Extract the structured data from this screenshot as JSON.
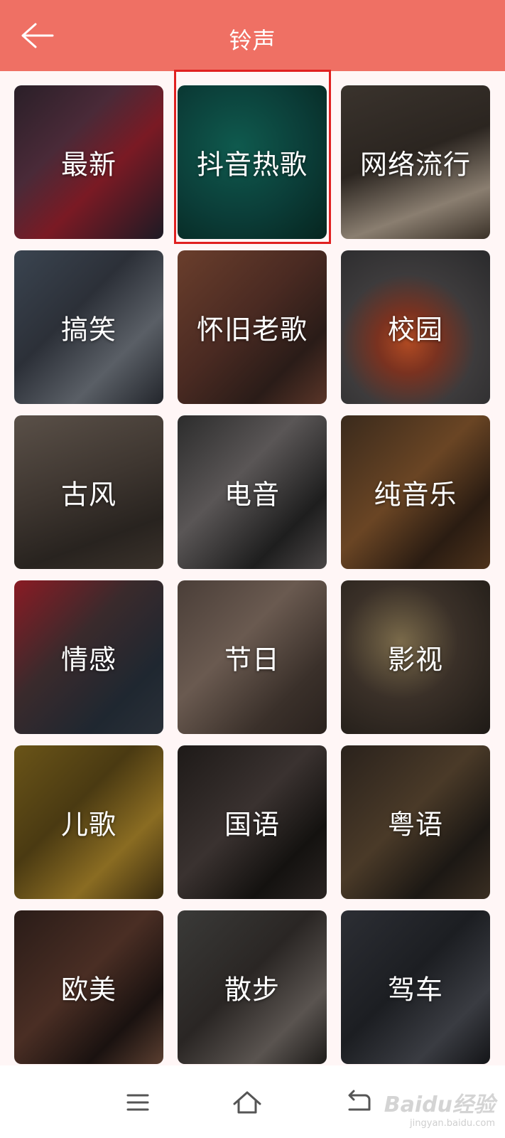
{
  "header": {
    "title": "铃声",
    "back_icon": "arrow-left-icon",
    "color": "#ef7064"
  },
  "categories": [
    {
      "label": "最新",
      "bg": "linear-gradient(135deg,#2a1f28 0%,#4a2a38 35%,#7a1a24 60%,#1d1a24 100%)"
    },
    {
      "label": "抖音热歌",
      "bg": "radial-gradient(circle at 40% 40%,#0f5a4e 0%,#0b3d38 55%,#06251f 100%)"
    },
    {
      "label": "网络流行",
      "bg": "linear-gradient(160deg,#3a332d 0%,#2b2520 45%,#8a7e70 75%,#3a3128 100%)"
    },
    {
      "label": "搞笑",
      "bg": "linear-gradient(135deg,#3a4450 0%,#2c3038 40%,#5a5f66 70%,#23262c 100%)"
    },
    {
      "label": "怀旧老歌",
      "bg": "linear-gradient(135deg,#6a3e2c 0%,#4a2a22 45%,#2a1c18 75%,#5a3528 100%)"
    },
    {
      "label": "校园",
      "bg": "radial-gradient(circle at 45% 60%,#b04a22 0%,#7a3220 25%,#3d3b3c 55%,#2a2a2c 100%)"
    },
    {
      "label": "古风",
      "bg": "linear-gradient(160deg,#5a5048 0%,#3e3630 45%,#28231f 75%,#3a322b 100%)"
    },
    {
      "label": "电音",
      "bg": "linear-gradient(135deg,#2c2c2c 0%,#5a5656 40%,#1e1e1e 75%,#4a4646 100%)"
    },
    {
      "label": "纯音乐",
      "bg": "linear-gradient(135deg,#3a2a1c 0%,#6a4524 45%,#2a1c12 75%,#4e331c 100%)"
    },
    {
      "label": "情感",
      "bg": "linear-gradient(135deg,#8a1b24 0%,#3a2a2c 40%,#1f2730 75%,#2a3038 100%)"
    },
    {
      "label": "节日",
      "bg": "linear-gradient(135deg,#4a3e38 0%,#6a5a50 40%,#3a302a 75%,#2a221e 100%)"
    },
    {
      "label": "影视",
      "bg": "radial-gradient(circle at 40% 40%,#7a6a4a 0%,#3a3028 45%,#1e1a16 100%)"
    },
    {
      "label": "儿歌",
      "bg": "linear-gradient(135deg,#6a5418 0%,#4a3a12 40%,#8a6c22 70%,#3a2c10 100%)"
    },
    {
      "label": "国语",
      "bg": "linear-gradient(135deg,#1e1a18 0%,#3a3230 45%,#141210 75%,#2a2422 100%)"
    },
    {
      "label": "粤语",
      "bg": "linear-gradient(135deg,#2a221c 0%,#4a3a28 45%,#1c1814 75%,#3a2e22 100%)"
    },
    {
      "label": "欧美",
      "bg": "linear-gradient(135deg,#2a1c18 0%,#4a2e24 45%,#1a1210 75%,#5a3e30 100%)"
    },
    {
      "label": "散步",
      "bg": "linear-gradient(135deg,#3a3a38 0%,#2a2624 45%,#5a5450 75%,#1e1c1a 100%)"
    },
    {
      "label": "驾车",
      "bg": "linear-gradient(135deg,#2c2e34 0%,#1c1e22 45%,#3a3c42 75%,#141518 100%)"
    }
  ],
  "highlight": {
    "target": "抖音热歌",
    "color": "#e02020"
  },
  "navbar": {
    "menu_icon": "menu-icon",
    "home_icon": "home-icon",
    "back_icon": "back-icon"
  },
  "watermark": {
    "logo": "Baidu经验",
    "url": "jingyan.baidu.com"
  }
}
